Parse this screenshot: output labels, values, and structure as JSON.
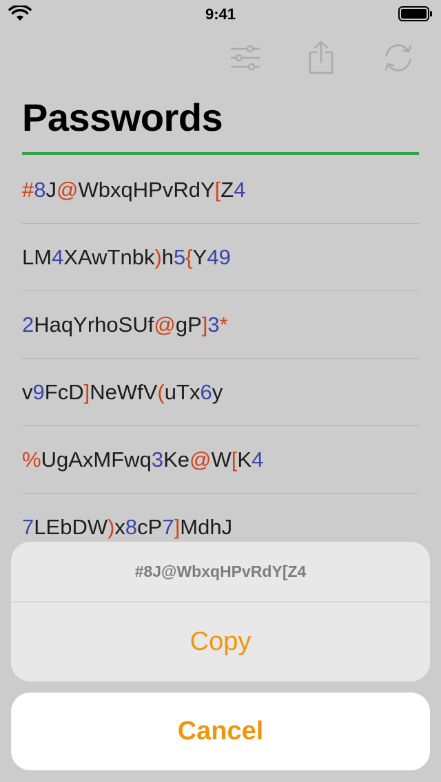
{
  "status": {
    "time": "9:41"
  },
  "toolbar": {
    "filter_icon": "sliders-icon",
    "share_icon": "share-icon",
    "refresh_icon": "refresh-icon"
  },
  "page": {
    "title": "Passwords",
    "accent_color": "#35a244"
  },
  "passwords": [
    "#8J@WbxqHPvRdY[Z4",
    "LM4XAwTnbk)h5{Y49",
    "2HaqYrhoSUf@gP]3*",
    "v9FcD]NeWfV(uTx6y",
    "%UgAxMFwq3Ke@W[K4",
    "7LEbDW)x8cP7]MdhJ"
  ],
  "colors": {
    "digit": "#3a45a8",
    "symbol": "#d0441a",
    "letter": "#1c1c1c",
    "action": "#f0960a"
  },
  "action_sheet": {
    "message": "#8J@WbxqHPvRdY[Z4",
    "copy_label": "Copy",
    "cancel_label": "Cancel"
  }
}
